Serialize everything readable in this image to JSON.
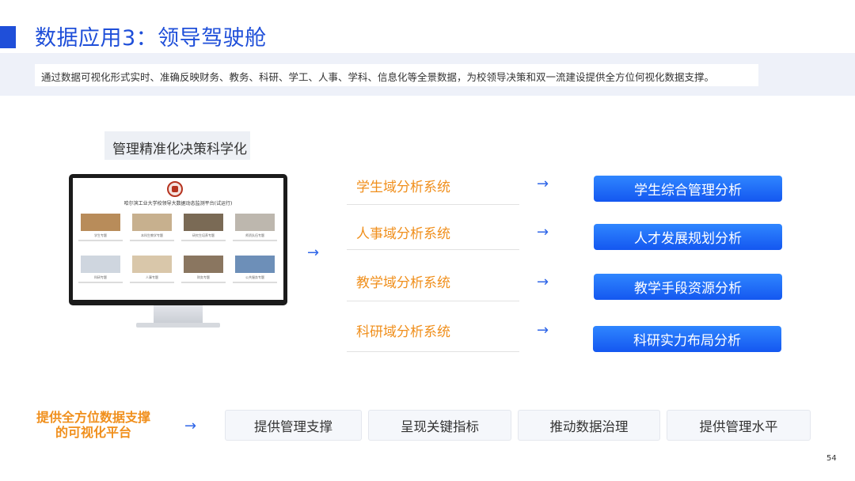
{
  "title": "数据应用3：领导驾驶舱",
  "subtitle": "通过数据可视化形式实时、准确反映财务、教务、科研、学工、人事、学科、信息化等全景数据，为校领导决策和双一流建设提供全方位何视化数据支撑。",
  "management_label": "管理精准化决策科学化",
  "monitor": {
    "screen_title": "哈尔滨工业大学校领导大数据动态监测平台(试运行)",
    "tiles": [
      "学生专题",
      "本科生教学专题",
      "研究生培养专题",
      "师资队伍专题",
      "科研专题",
      "人事专题",
      "财务专题",
      "公共服务专题"
    ]
  },
  "systems": [
    {
      "name": "学生域分析系统",
      "button": "学生综合管理分析"
    },
    {
      "name": "人事域分析系统",
      "button": "人才发展规划分析"
    },
    {
      "name": "教学域分析系统",
      "button": "教学手段资源分析"
    },
    {
      "name": "科研域分析系统",
      "button": "科研实力布局分析"
    }
  ],
  "bottom": {
    "label_line1": "提供全方位数据支撑",
    "label_line2": "的可视化平台",
    "items": [
      "提供管理支撑",
      "呈现关键指标",
      "推动数据治理",
      "提供管理水平"
    ]
  },
  "page_number": "54",
  "colors": {
    "accent_blue": "#1f4fd9",
    "accent_orange": "#f08f1c",
    "button_blue": "#1e6bf5"
  },
  "icons": {
    "arrow": "right-arrow-icon",
    "seal": "university-seal-icon"
  }
}
